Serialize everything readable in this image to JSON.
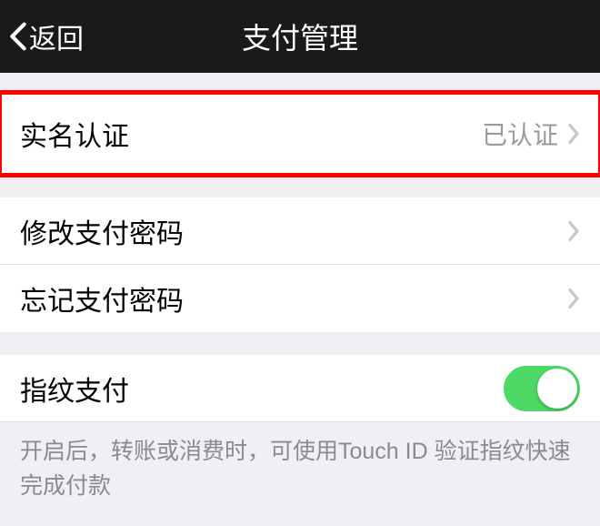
{
  "header": {
    "back_label": "返回",
    "title": "支付管理"
  },
  "real_name": {
    "label": "实名认证",
    "status": "已认证"
  },
  "password": {
    "modify_label": "修改支付密码",
    "forgot_label": "忘记支付密码"
  },
  "fingerprint": {
    "label": "指纹支付",
    "enabled": true,
    "hint": "开启后，转账或消费时，可使用Touch ID 验证指纹快速完成付款"
  }
}
